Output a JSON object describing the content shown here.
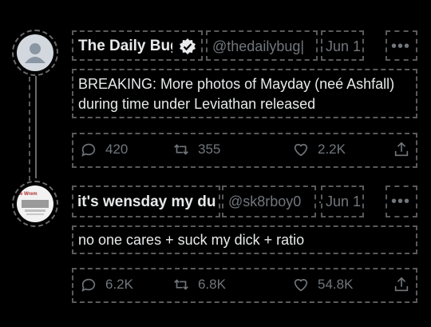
{
  "tweets": [
    {
      "author_name": "The Daily Bug|",
      "handle": "@thedailybug|",
      "separator": "·",
      "date": "Jun 1",
      "text": "BREAKING: More photos of Mayday (neé Ashfall) during time under Leviathan released",
      "replies": "420",
      "retweets": "355",
      "likes": "2.2K",
      "verified": true
    },
    {
      "author_name": "it's wensday my du(",
      "handle": "@sk8rboy0",
      "separator": "·",
      "date": "Jun 1",
      "text": "no one cares + suck my dick + ratio",
      "replies": "6.2K",
      "retweets": "6.8K",
      "likes": "54.8K",
      "avatar_text": "te Wrem"
    }
  ],
  "more_label": "•••",
  "colors": {
    "background": "#000000",
    "text": "#e7e9ea",
    "muted": "#71767b",
    "dash": "#5a5a5a"
  },
  "icons": [
    "reply-icon",
    "retweet-icon",
    "like-icon",
    "share-icon",
    "verified-badge-icon",
    "more-icon"
  ]
}
